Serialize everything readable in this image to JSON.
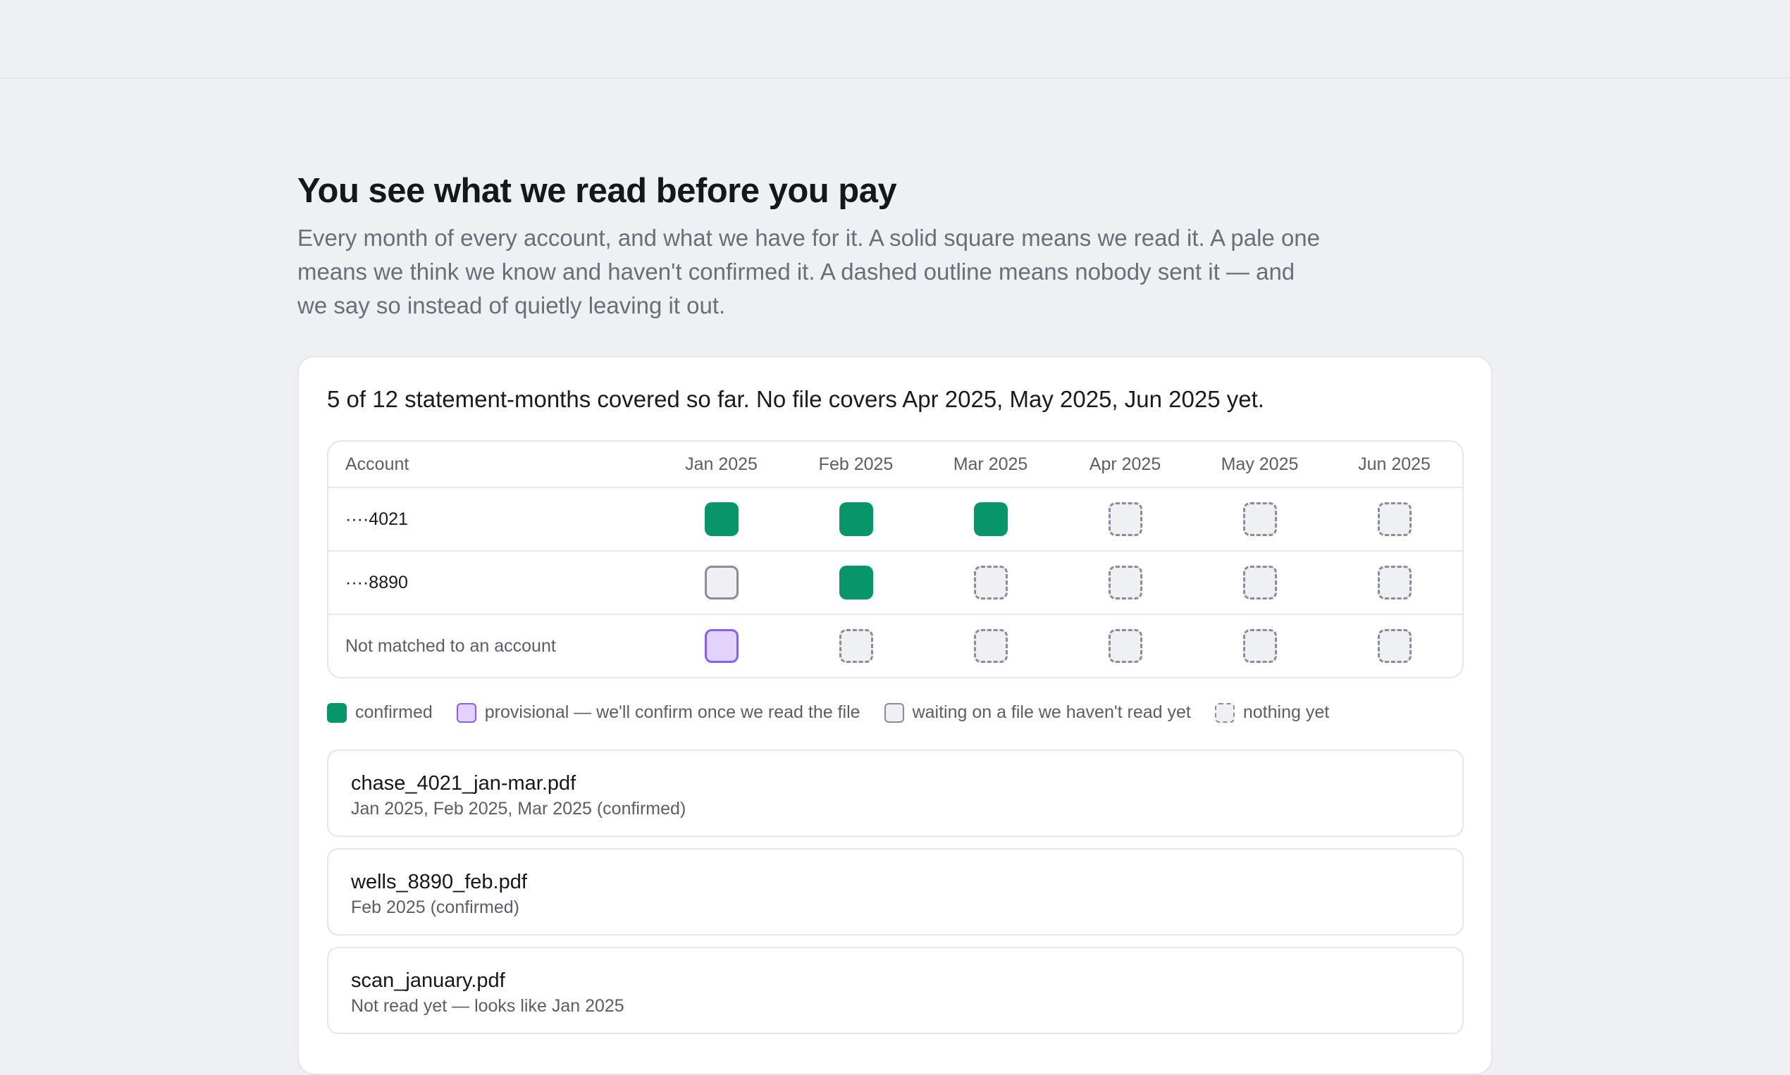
{
  "header": {
    "title": "You see what we read before you pay",
    "intro": "Every month of every account, and what we have for it. A solid square means we read it. A pale one means we think we know and haven't confirmed it. A dashed outline means nobody sent it — and we say so instead of quietly leaving it out."
  },
  "summary": "5 of 12 statement-months covered so far. No file covers Apr 2025, May 2025, Jun 2025 yet.",
  "grid": {
    "account_header": "Account",
    "months": [
      "Jan 2025",
      "Feb 2025",
      "Mar 2025",
      "Apr 2025",
      "May 2025",
      "Jun 2025"
    ],
    "rows": [
      {
        "account": "····4021",
        "statuses": [
          "confirmed",
          "confirmed",
          "confirmed",
          "nothing",
          "nothing",
          "nothing"
        ]
      },
      {
        "account": "····8890",
        "statuses": [
          "waiting",
          "confirmed",
          "nothing",
          "nothing",
          "nothing",
          "nothing"
        ]
      },
      {
        "account": "Not matched to an account",
        "statuses": [
          "provisional",
          "nothing",
          "nothing",
          "nothing",
          "nothing",
          "nothing"
        ]
      }
    ]
  },
  "legend": {
    "confirmed": "confirmed",
    "provisional": "provisional — we'll confirm once we read the file",
    "waiting": "waiting on a file we haven't read yet",
    "nothing": "nothing yet"
  },
  "files": [
    {
      "name": "chase_4021_jan-mar.pdf",
      "meta": "Jan 2025, Feb 2025, Mar 2025 (confirmed)"
    },
    {
      "name": "wells_8890_feb.pdf",
      "meta": "Feb 2025 (confirmed)"
    },
    {
      "name": "scan_january.pdf",
      "meta": "Not read yet — looks like Jan 2025"
    }
  ],
  "colors": {
    "confirmed": "#079669",
    "provisional_fill": "#e2d3fb",
    "provisional_border": "#8b5cf6",
    "outline": "#8a8c98",
    "page_background": "#eef0f3"
  }
}
